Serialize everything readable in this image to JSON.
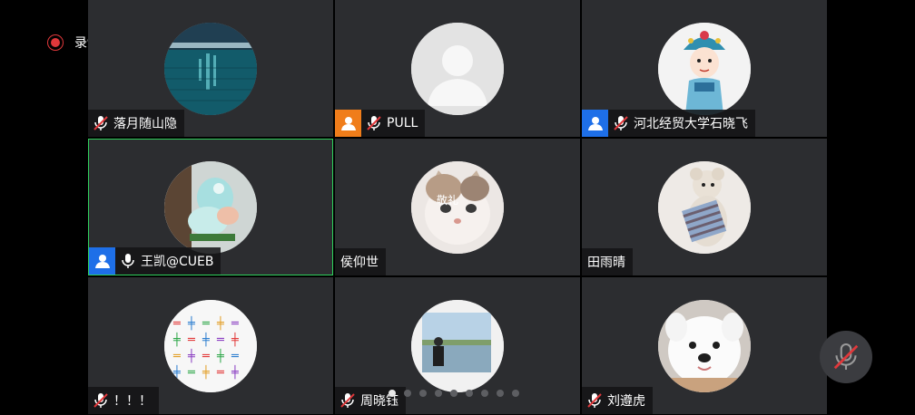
{
  "recording": {
    "label": "录制中",
    "color": "#e0383b"
  },
  "participants": [
    {
      "name": "落月随山隐",
      "mic": "muted",
      "badge": null,
      "avatar": "night-river-photo",
      "active": false
    },
    {
      "name": "PULL",
      "mic": "muted",
      "badge": "orange-user-badge",
      "avatar": "default-person-placeholder",
      "active": false
    },
    {
      "name": "河北经贸大学石晓飞",
      "mic": "muted",
      "badge": "blue-user-badge",
      "avatar": "opera-cartoon-character",
      "active": false
    },
    {
      "name": "王凯@CUEB",
      "mic": "on",
      "badge": "blue-user-badge",
      "avatar": "jade-carving-photo",
      "active": true
    },
    {
      "name": "侯仰世",
      "mic": "none",
      "badge": null,
      "avatar": "kitten-photo",
      "active": false
    },
    {
      "name": "田雨晴",
      "mic": "none",
      "badge": null,
      "avatar": "plush-toy-photo",
      "active": false
    },
    {
      "name": "！！！",
      "mic": "muted",
      "badge": null,
      "avatar": "colorful-calligraphy-image",
      "active": false
    },
    {
      "name": "周晓钰",
      "mic": "muted",
      "badge": null,
      "avatar": "person-by-lake-photo",
      "active": false
    },
    {
      "name": "刘遵虎",
      "mic": "muted",
      "badge": null,
      "avatar": "white-puppy-photo",
      "active": false
    }
  ],
  "avatar_text": {
    "kitten": "敬礼"
  },
  "pagination": {
    "pages": 9,
    "current": 1
  },
  "floating_button": {
    "icon": "muted-mic-icon"
  },
  "colors": {
    "tile_bg": "#2c2d30",
    "active_border": "#2fd15c",
    "mic_muted": "#e0383b",
    "badge_orange": "#f07d1a",
    "badge_blue": "#1e6fe8"
  }
}
